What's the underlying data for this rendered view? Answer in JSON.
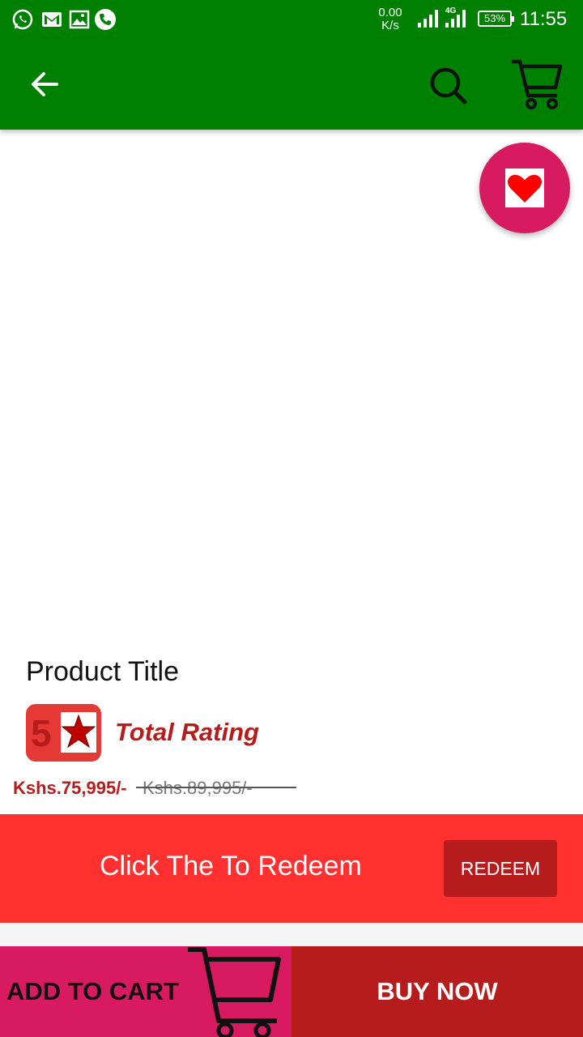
{
  "status_bar": {
    "net_speed_value": "0.00",
    "net_speed_unit": "K/s",
    "network_label": "4G",
    "battery": "53%",
    "time": "11:55",
    "icons": [
      "whatsapp-icon",
      "gmail-icon",
      "gallery-icon",
      "phone-icon",
      "signal-icon",
      "battery-icon"
    ]
  },
  "app_bar": {
    "icons": [
      "back-arrow-icon",
      "search-icon",
      "cart-icon"
    ],
    "color": "#008000"
  },
  "product": {
    "title": "Product Title",
    "rating_value": "5",
    "rating_label": "Total Rating",
    "price_current": "Kshs.75,995/-",
    "price_old": "Kshs.89,995/-"
  },
  "redeem": {
    "text": "Click The To Redeem",
    "button_label": "REDEEM"
  },
  "bottom_bar": {
    "add_to_cart_label": "ADD TO CART",
    "buy_now_label": "BUY NOW"
  },
  "colors": {
    "primary_green": "#008000",
    "pink": "#D81B60",
    "red": "#FF3030",
    "dark_red": "#B71C1C"
  }
}
